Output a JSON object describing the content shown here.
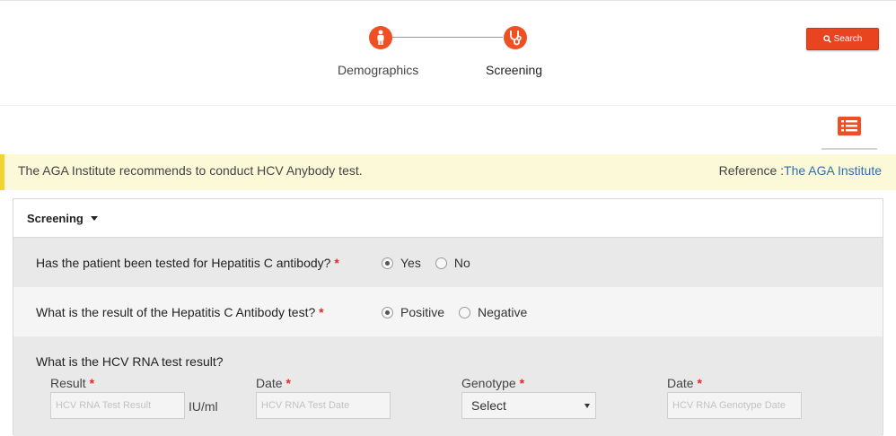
{
  "header": {
    "steps": [
      {
        "label": "Demographics",
        "icon": "person-icon"
      },
      {
        "label": "Screening",
        "icon": "stethoscope-icon"
      }
    ],
    "search_label": "Search",
    "accent_color": "#f04e23"
  },
  "alert": {
    "text": "The AGA Institute recommends to conduct HCV Anybody test.",
    "reference_prefix": "Reference :",
    "reference_link": "The AGA Institute"
  },
  "panel": {
    "title": "Screening",
    "q1": {
      "text": "Has the patient been tested for Hepatitis C antibody?",
      "options": [
        "Yes",
        "No"
      ],
      "selected": "Yes"
    },
    "q2": {
      "text": "What is the result of the Hepatitis C Antibody test?",
      "options": [
        "Positive",
        "Negative"
      ],
      "selected": "Positive"
    },
    "q3": {
      "text": "What is the HCV RNA test result?",
      "result_label": "Result",
      "result_placeholder": "HCV RNA Test Result",
      "unit": "IU/ml",
      "date_label": "Date",
      "date_placeholder": "HCV RNA Test Date",
      "genotype_label": "Genotype",
      "genotype_value": "Select",
      "genotype_date_label": "Date",
      "genotype_date_placeholder": "HCV RNA Genotype Date"
    },
    "required_mark": "*"
  }
}
